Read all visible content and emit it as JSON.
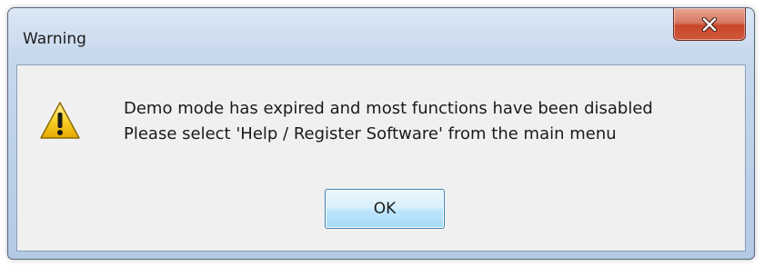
{
  "window": {
    "title": "Warning",
    "close_icon": "close-x-icon"
  },
  "message": {
    "icon": "warning-triangle-icon",
    "line1": "Demo mode has expired and most functions have been disabled",
    "line2": "Please select 'Help / Register Software' from the main menu"
  },
  "buttons": {
    "ok_label": "OK"
  },
  "colors": {
    "close_button": "#c9462a",
    "warning_yellow": "#f5c518",
    "ok_button_border": "#3c7fb1",
    "client_bg": "#f0f0f0"
  }
}
